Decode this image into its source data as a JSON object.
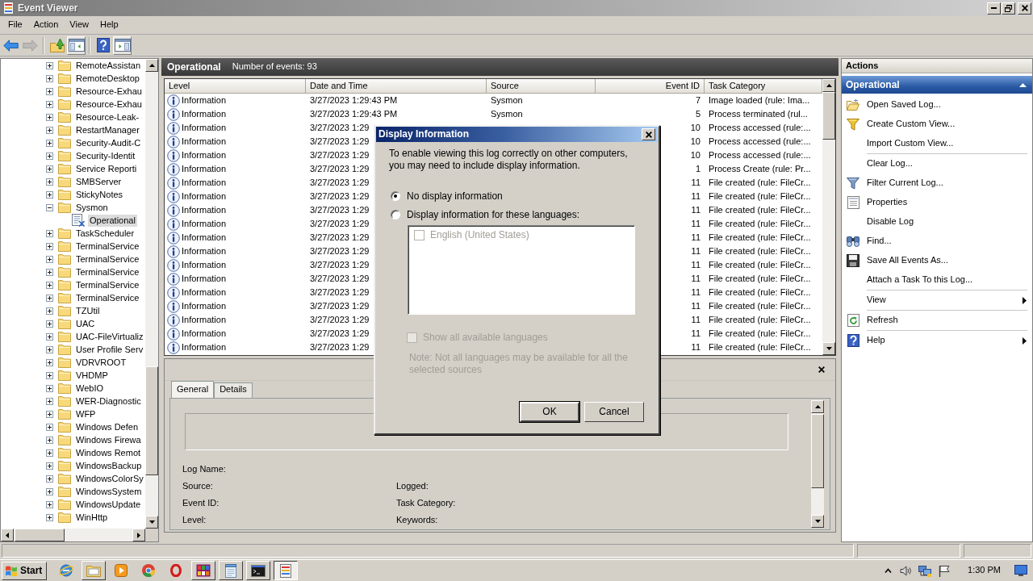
{
  "window": {
    "title": "Event Viewer"
  },
  "menu": [
    "File",
    "Action",
    "View",
    "Help"
  ],
  "toolbar": [
    [
      {
        "disabled": false,
        "pressed": false
      },
      {
        "disabled": true,
        "pressed": false
      }
    ],
    [
      {
        "disabled": false,
        "pressed": false
      },
      {
        "disabled": false,
        "pressed": true
      }
    ],
    [
      {
        "disabled": false,
        "pressed": false
      },
      {
        "disabled": false,
        "pressed": true
      }
    ]
  ],
  "tree": [
    {
      "label": "RemoteAssistan",
      "expanded": false,
      "selected": false
    },
    {
      "label": "RemoteDesktop",
      "expanded": false,
      "selected": false
    },
    {
      "label": "Resource-Exhau",
      "expanded": false,
      "selected": false
    },
    {
      "label": "Resource-Exhau",
      "expanded": false,
      "selected": false
    },
    {
      "label": "Resource-Leak-",
      "expanded": false,
      "selected": false
    },
    {
      "label": "RestartManager",
      "expanded": false,
      "selected": false
    },
    {
      "label": "Security-Audit-C",
      "expanded": false,
      "selected": false
    },
    {
      "label": "Security-Identit",
      "expanded": false,
      "selected": false
    },
    {
      "label": "Service Reporti",
      "expanded": false,
      "selected": false
    },
    {
      "label": "SMBServer",
      "expanded": false,
      "selected": false
    },
    {
      "label": "StickyNotes",
      "expanded": false,
      "selected": false
    },
    {
      "label": "Sysmon",
      "expanded": true,
      "selected": false,
      "children": [
        {
          "label": "Operational",
          "selected": true
        }
      ]
    },
    {
      "label": "TaskScheduler",
      "expanded": false,
      "selected": false
    },
    {
      "label": "TerminalService",
      "expanded": false,
      "selected": false
    },
    {
      "label": "TerminalService",
      "expanded": false,
      "selected": false
    },
    {
      "label": "TerminalService",
      "expanded": false,
      "selected": false
    },
    {
      "label": "TerminalService",
      "expanded": false,
      "selected": false
    },
    {
      "label": "TerminalService",
      "expanded": false,
      "selected": false
    },
    {
      "label": "TZUtil",
      "expanded": false,
      "selected": false
    },
    {
      "label": "UAC",
      "expanded": false,
      "selected": false
    },
    {
      "label": "UAC-FileVirtualiz",
      "expanded": false,
      "selected": false
    },
    {
      "label": "User Profile Serv",
      "expanded": false,
      "selected": false
    },
    {
      "label": "VDRVROOT",
      "expanded": false,
      "selected": false
    },
    {
      "label": "VHDMP",
      "expanded": false,
      "selected": false
    },
    {
      "label": "WebIO",
      "expanded": false,
      "selected": false
    },
    {
      "label": "WER-Diagnostic",
      "expanded": false,
      "selected": false
    },
    {
      "label": "WFP",
      "expanded": false,
      "selected": false
    },
    {
      "label": "Windows Defen",
      "expanded": false,
      "selected": false
    },
    {
      "label": "Windows Firewa",
      "expanded": false,
      "selected": false
    },
    {
      "label": "Windows Remot",
      "expanded": false,
      "selected": false
    },
    {
      "label": "WindowsBackup",
      "expanded": false,
      "selected": false
    },
    {
      "label": "WindowsColorSy",
      "expanded": false,
      "selected": false
    },
    {
      "label": "WindowsSystem",
      "expanded": false,
      "selected": false
    },
    {
      "label": "WindowsUpdate",
      "expanded": false,
      "selected": false
    },
    {
      "label": "WinHttp",
      "expanded": false,
      "selected": false
    }
  ],
  "log_header": {
    "title": "Operational",
    "summary": "Number of events: 93"
  },
  "events": {
    "columns": [
      "Level",
      "Date and Time",
      "Source",
      "Event ID",
      "Task Category"
    ],
    "rows": [
      {
        "level": "Information",
        "date_time": "3/27/2023 1:29:43 PM",
        "source": "Sysmon",
        "event_id": "7",
        "task_category": "Image loaded (rule: Ima..."
      },
      {
        "level": "Information",
        "date_time": "3/27/2023 1:29:43 PM",
        "source": "Sysmon",
        "event_id": "5",
        "task_category": "Process terminated (rul..."
      },
      {
        "level": "Information",
        "date_time": "3/27/2023 1:29",
        "event_id": "10",
        "task_category": "Process accessed (rule:..."
      },
      {
        "level": "Information",
        "date_time": "3/27/2023 1:29",
        "event_id": "10",
        "task_category": "Process accessed (rule:..."
      },
      {
        "level": "Information",
        "date_time": "3/27/2023 1:29",
        "event_id": "10",
        "task_category": "Process accessed (rule:..."
      },
      {
        "level": "Information",
        "date_time": "3/27/2023 1:29",
        "event_id": "1",
        "task_category": "Process Create (rule: Pr..."
      },
      {
        "level": "Information",
        "date_time": "3/27/2023 1:29",
        "event_id": "11",
        "task_category": "File created (rule: FileCr..."
      },
      {
        "level": "Information",
        "date_time": "3/27/2023 1:29",
        "event_id": "11",
        "task_category": "File created (rule: FileCr..."
      },
      {
        "level": "Information",
        "date_time": "3/27/2023 1:29",
        "event_id": "11",
        "task_category": "File created (rule: FileCr..."
      },
      {
        "level": "Information",
        "date_time": "3/27/2023 1:29",
        "event_id": "11",
        "task_category": "File created (rule: FileCr..."
      },
      {
        "level": "Information",
        "date_time": "3/27/2023 1:29",
        "event_id": "11",
        "task_category": "File created (rule: FileCr..."
      },
      {
        "level": "Information",
        "date_time": "3/27/2023 1:29",
        "event_id": "11",
        "task_category": "File created (rule: FileCr..."
      },
      {
        "level": "Information",
        "date_time": "3/27/2023 1:29",
        "event_id": "11",
        "task_category": "File created (rule: FileCr..."
      },
      {
        "level": "Information",
        "date_time": "3/27/2023 1:29",
        "event_id": "11",
        "task_category": "File created (rule: FileCr..."
      },
      {
        "level": "Information",
        "date_time": "3/27/2023 1:29",
        "event_id": "11",
        "task_category": "File created (rule: FileCr..."
      },
      {
        "level": "Information",
        "date_time": "3/27/2023 1:29",
        "event_id": "11",
        "task_category": "File created (rule: FileCr..."
      },
      {
        "level": "Information",
        "date_time": "3/27/2023 1:29",
        "event_id": "11",
        "task_category": "File created (rule: FileCr..."
      },
      {
        "level": "Information",
        "date_time": "3/27/2023 1:29",
        "event_id": "11",
        "task_category": "File created (rule: FileCr..."
      },
      {
        "level": "Information",
        "date_time": "3/27/2023 1:29",
        "event_id": "11",
        "task_category": "File created (rule: FileCr..."
      }
    ]
  },
  "details": {
    "tabs": [
      {
        "label": "General",
        "selected": true
      },
      {
        "label": "Details",
        "selected": false
      }
    ],
    "fields": [
      [
        "Log Name:"
      ],
      [
        "Source:",
        "Logged:"
      ],
      [
        "Event ID:",
        "Task Category:"
      ],
      [
        "Level:",
        "Keywords:"
      ]
    ]
  },
  "actions": {
    "title": "Actions",
    "section": {
      "title": "Operational",
      "expanded": true
    },
    "groups": [
      [
        {
          "label": "Open Saved Log...",
          "submenu": false
        },
        {
          "label": "Create Custom View...",
          "submenu": false
        },
        {
          "label": "Import Custom View...",
          "submenu": false
        }
      ],
      [
        {
          "label": "Clear Log...",
          "submenu": false
        },
        {
          "label": "Filter Current Log...",
          "submenu": false
        },
        {
          "label": "Properties",
          "submenu": false
        },
        {
          "label": "Disable Log",
          "submenu": false
        },
        {
          "label": "Find...",
          "submenu": false
        },
        {
          "label": "Save All Events As...",
          "submenu": false
        },
        {
          "label": "Attach a Task To this Log...",
          "submenu": false
        }
      ],
      [
        {
          "label": "View",
          "submenu": true
        }
      ],
      [
        {
          "label": "Refresh",
          "submenu": false
        }
      ],
      [
        {
          "label": "Help",
          "submenu": true
        }
      ]
    ]
  },
  "dialog": {
    "title": "Display Information",
    "message": "To enable viewing this log correctly on other computers, you may need to include display information.",
    "options": [
      {
        "label": "No display information",
        "selected": true
      },
      {
        "label": "Display information for these languages:",
        "selected": false
      }
    ],
    "languages": [
      {
        "label": "English (United States)",
        "checked": false,
        "disabled": true
      }
    ],
    "show_all": {
      "label": "Show all available languages",
      "checked": false,
      "disabled": true
    },
    "note": "Note: Not all languages may be available for all the selected sources",
    "buttons": [
      {
        "label": "OK",
        "default": true
      },
      {
        "label": "Cancel",
        "default": false
      }
    ]
  },
  "taskbar": {
    "start": "Start",
    "apps": [
      {
        "running": false,
        "selected": false
      },
      {
        "running": true,
        "selected": false
      },
      {
        "running": false,
        "selected": false
      },
      {
        "running": false,
        "selected": false
      },
      {
        "running": false,
        "selected": false
      },
      {
        "running": true,
        "selected": false
      },
      {
        "running": true,
        "selected": false
      },
      {
        "running": true,
        "selected": false
      },
      {
        "running": true,
        "selected": true
      }
    ],
    "clock": "1:30 PM"
  }
}
